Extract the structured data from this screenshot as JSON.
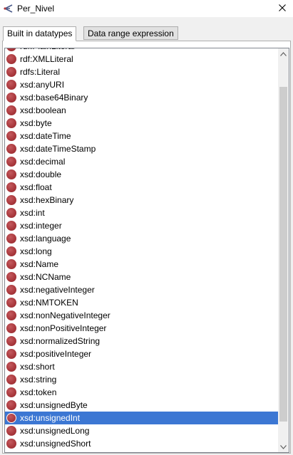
{
  "window": {
    "title": "Per_Nivel"
  },
  "tabs": [
    {
      "label": "Built in datatypes",
      "active": true
    },
    {
      "label": "Data range expression",
      "active": false
    }
  ],
  "icons": {
    "app": "protege-icon",
    "close": "close-icon",
    "item": "datatype-icon"
  },
  "colors": {
    "selection": "#3c77d3",
    "item_icon": "#a8363b"
  },
  "datatypes": [
    {
      "label": "rdf:PlainLiteral"
    },
    {
      "label": "rdf:XMLLiteral"
    },
    {
      "label": "rdfs:Literal"
    },
    {
      "label": "xsd:anyURI"
    },
    {
      "label": "xsd:base64Binary"
    },
    {
      "label": "xsd:boolean"
    },
    {
      "label": "xsd:byte"
    },
    {
      "label": "xsd:dateTime"
    },
    {
      "label": "xsd:dateTimeStamp"
    },
    {
      "label": "xsd:decimal"
    },
    {
      "label": "xsd:double"
    },
    {
      "label": "xsd:float"
    },
    {
      "label": "xsd:hexBinary"
    },
    {
      "label": "xsd:int"
    },
    {
      "label": "xsd:integer"
    },
    {
      "label": "xsd:language"
    },
    {
      "label": "xsd:long"
    },
    {
      "label": "xsd:Name"
    },
    {
      "label": "xsd:NCName"
    },
    {
      "label": "xsd:negativeInteger"
    },
    {
      "label": "xsd:NMTOKEN"
    },
    {
      "label": "xsd:nonNegativeInteger"
    },
    {
      "label": "xsd:nonPositiveInteger"
    },
    {
      "label": "xsd:normalizedString"
    },
    {
      "label": "xsd:positiveInteger"
    },
    {
      "label": "xsd:short"
    },
    {
      "label": "xsd:string"
    },
    {
      "label": "xsd:token"
    },
    {
      "label": "xsd:unsignedByte"
    },
    {
      "label": "xsd:unsignedInt",
      "selected": true
    },
    {
      "label": "xsd:unsignedLong"
    },
    {
      "label": "xsd:unsignedShort"
    }
  ]
}
